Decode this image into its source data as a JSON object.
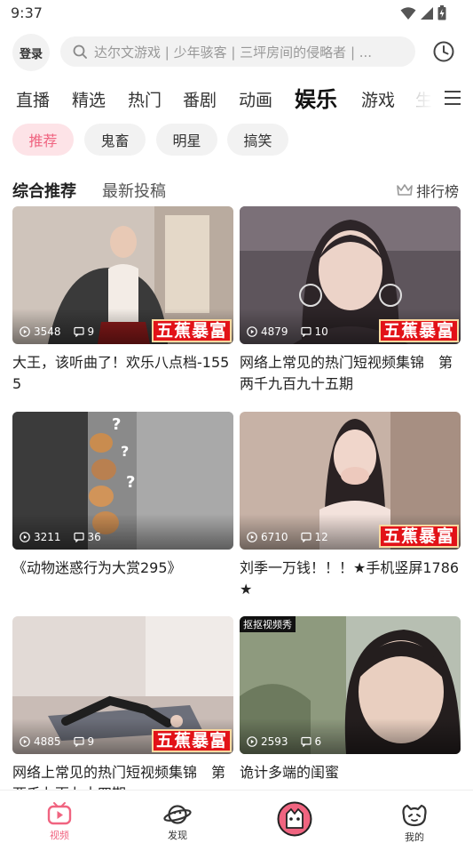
{
  "status": {
    "time": "9:37"
  },
  "header": {
    "login_label": "登录",
    "search_placeholder": "达尔文游戏 | 少年骇客 | 三坪房间的侵略者 | ..."
  },
  "categories": [
    "直播",
    "精选",
    "热门",
    "番剧",
    "动画",
    "娱乐",
    "游戏",
    "生"
  ],
  "active_category": "娱乐",
  "sub_tabs": [
    "推荐",
    "鬼畜",
    "明星",
    "搞笑"
  ],
  "feed": {
    "tabs": [
      "综合推荐",
      "最新投稿"
    ],
    "rank_label": "排行榜"
  },
  "videos": [
    {
      "title": "大王，该听曲了！欢乐八点档-1555",
      "plays": "3548",
      "comments": "9",
      "banner": "五蕉暴富"
    },
    {
      "title": "网络上常见的热门短视频集锦　第两千九百九十五期",
      "plays": "4879",
      "comments": "10",
      "banner": "五蕉暴富"
    },
    {
      "title": "《动物迷惑行为大赏295》",
      "plays": "3211",
      "comments": "36",
      "banner": ""
    },
    {
      "title": "刘季一万钱！！！★手机竖屏1786★",
      "plays": "6710",
      "comments": "12",
      "banner": "五蕉暴富"
    },
    {
      "title": "网络上常见的热门短视频集锦　第两千九百九十四期",
      "plays": "4885",
      "comments": "9",
      "banner": "五蕉暴富"
    },
    {
      "title": "诡计多端的闺蜜",
      "plays": "2593",
      "comments": "6",
      "banner": "",
      "tag": "抠抠视频秀"
    }
  ],
  "bottom_nav": [
    {
      "label": "视频",
      "icon": "tv-icon",
      "active": true
    },
    {
      "label": "发现",
      "icon": "planet-icon",
      "active": false
    },
    {
      "label": "",
      "icon": "center-mascot-icon",
      "active": false
    },
    {
      "label": "我的",
      "icon": "mascot-face-icon",
      "active": false
    }
  ],
  "colors": {
    "accent": "#f06480",
    "accent_light": "#fde3e7",
    "banner_red": "#e21218"
  }
}
